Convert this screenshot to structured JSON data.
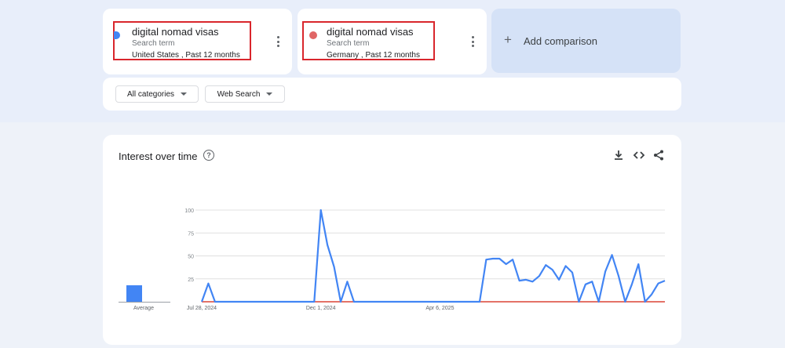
{
  "terms": [
    {
      "title": "digital nomad visas",
      "subtitle": "Search term",
      "meta": "United States , Past 12 months",
      "color": "#4285f4",
      "menu_icon": "more-vert-icon"
    },
    {
      "title": "digital nomad visas",
      "subtitle": "Search term",
      "meta": "Germany , Past 12 months",
      "color": "#db4437",
      "menu_icon": "more-vert-icon"
    }
  ],
  "add_comparison": {
    "icon": "plus-icon",
    "label": "Add comparison"
  },
  "filters": {
    "categories": "All categories",
    "search_type": "Web Search"
  },
  "chart_panel": {
    "title": "Interest over time",
    "icons": [
      "help-icon",
      "download-icon",
      "embed-icon",
      "share-icon"
    ],
    "average_label": "Average"
  },
  "chart_data": {
    "type": "line",
    "title": "Interest over time",
    "ylim": [
      0,
      100
    ],
    "yticks": [
      100,
      75,
      50,
      25
    ],
    "xtick_labels": [
      "Jul 28, 2024",
      "Dec 1, 2024",
      "Apr 6, 2025"
    ],
    "grid": true,
    "series": [
      {
        "color": "#4285f4",
        "values": [
          0,
          20,
          0,
          0,
          0,
          0,
          0,
          0,
          0,
          0,
          0,
          0,
          0,
          0,
          0,
          0,
          0,
          0,
          100,
          62,
          38,
          0,
          22,
          0,
          0,
          0,
          0,
          0,
          0,
          0,
          0,
          0,
          0,
          0,
          0,
          0,
          0,
          0,
          0,
          0,
          0,
          0,
          0,
          46,
          47,
          47,
          41,
          46,
          23,
          24,
          22,
          28,
          40,
          35,
          24,
          39,
          32,
          0,
          19,
          22,
          0,
          33,
          51,
          28,
          0,
          19,
          41,
          0,
          8,
          20,
          23
        ]
      },
      {
        "color": "#db4437",
        "values": [
          0,
          0,
          0,
          0,
          0,
          0,
          0,
          0,
          0,
          0,
          0,
          0,
          0,
          0,
          0,
          0,
          0,
          0,
          0,
          0,
          0,
          0,
          0,
          0,
          0,
          0,
          0,
          0,
          0,
          0,
          0,
          0,
          0,
          0,
          0,
          0,
          0,
          0,
          0,
          0,
          0,
          0,
          0,
          0,
          0,
          0,
          0,
          0,
          0,
          0,
          0,
          0,
          0,
          0,
          0,
          0,
          0,
          0,
          0,
          0,
          0,
          0,
          0,
          0,
          0,
          0,
          0,
          0,
          0,
          0,
          0
        ]
      }
    ],
    "averages": [
      18,
      0
    ]
  }
}
